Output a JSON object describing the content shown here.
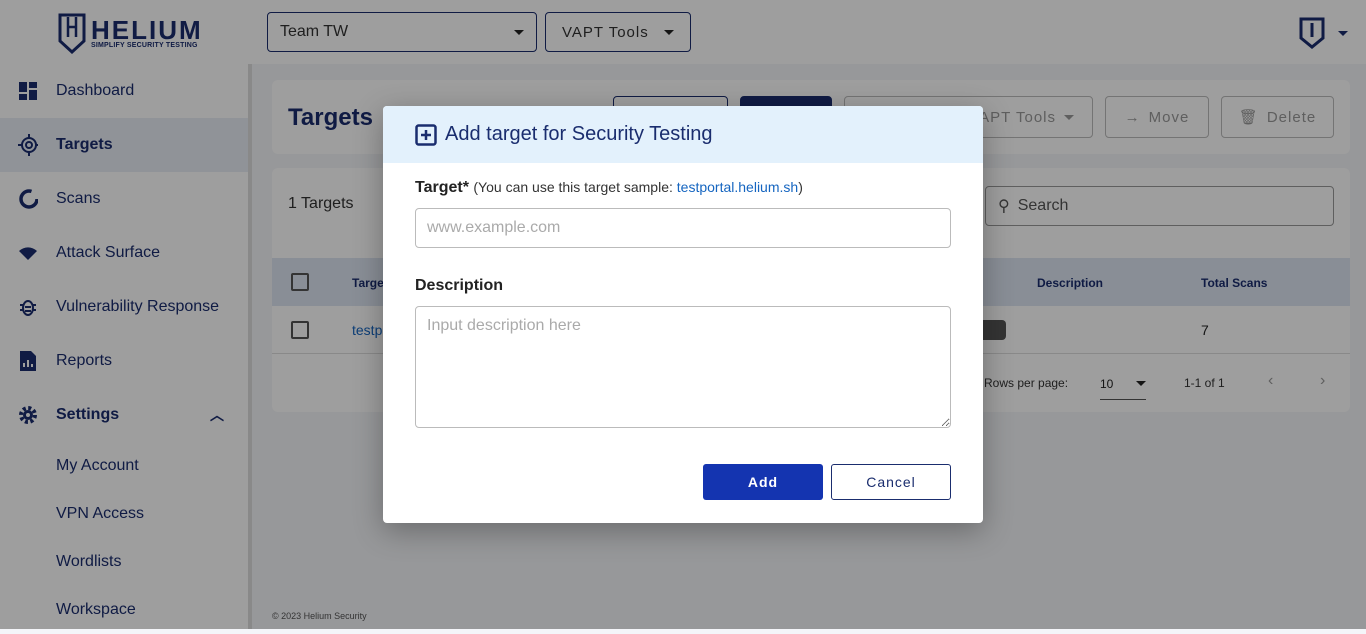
{
  "brand": {
    "name": "HELIUM",
    "tagline": "SIMPLIFY SECURITY TESTING"
  },
  "header": {
    "team": "Team TW",
    "tools": "VAPT Tools"
  },
  "sidebar": {
    "items": [
      {
        "label": "Dashboard",
        "icon": "dashboard-icon"
      },
      {
        "label": "Targets",
        "icon": "target-icon"
      },
      {
        "label": "Scans",
        "icon": "scan-icon"
      },
      {
        "label": "Attack Surface",
        "icon": "wifi-icon"
      },
      {
        "label": "Vulnerability Response",
        "icon": "bug-icon"
      },
      {
        "label": "Reports",
        "icon": "report-icon"
      }
    ],
    "settings": {
      "label": "Settings",
      "items": [
        "My Account",
        "VPN Access",
        "Wordlists",
        "Workspace"
      ]
    }
  },
  "page": {
    "title": "Targets",
    "toolbar": {
      "tools": "VAPT Tools",
      "move": "Move",
      "delete": "Delete"
    },
    "count": "1 Targets",
    "search_placeholder": "Search",
    "columns": [
      "Target",
      "Description",
      "Total Scans"
    ],
    "rows": [
      {
        "target": "testportal.helium.sh",
        "total_scans": "7"
      }
    ],
    "pagination": {
      "rows_label": "Rows per page:",
      "rows_value": "10",
      "range": "1-1 of 1"
    },
    "footer": "© 2023 Helium Security"
  },
  "modal": {
    "title": "Add target for Security Testing",
    "target_label": "Target*",
    "hint_prefix": "(You can use this target sample: ",
    "hint_link": "testportal.helium.sh",
    "hint_suffix": ")",
    "target_placeholder": "www.example.com",
    "description_label": "Description",
    "description_placeholder": "Input description here",
    "add": "Add",
    "cancel": "Cancel"
  },
  "colors": {
    "primary": "#1a2d6e",
    "button": "#1434b0",
    "modal_header": "#e3f1fc",
    "link": "#1565c0"
  }
}
